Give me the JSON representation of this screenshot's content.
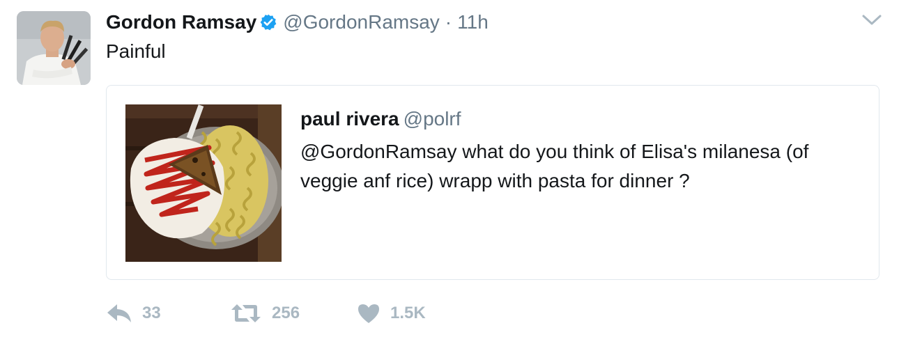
{
  "tweet": {
    "author_name": "Gordon Ramsay",
    "handle": "@GordonRamsay",
    "separator": "·",
    "time": "11h",
    "text": "Painful",
    "avatar_icon": "chef-avatar-with-knives",
    "verified_icon": "verified-badge-icon",
    "verified_color": "#1da1f2"
  },
  "quoted": {
    "author_name": "paul rivera",
    "handle": "@polrf",
    "text": "@GordonRamsay what do you think of Elisa's milanesa (of veggie anf rice) wrapp with pasta for dinner ?",
    "media_icon": "food-photo-milanesa-pasta"
  },
  "actions": {
    "reply_count": "33",
    "retweet_count": "256",
    "like_count": "1.5K",
    "icon_color": "#aab8c2"
  }
}
